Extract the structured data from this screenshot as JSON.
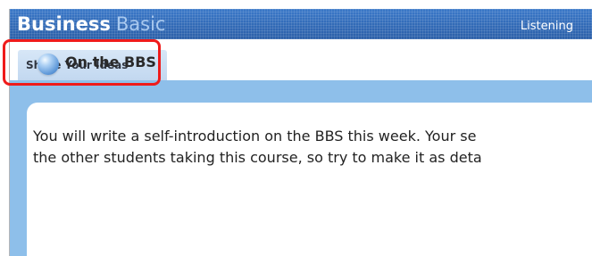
{
  "header": {
    "brand_strong": "Business",
    "brand_light": "Basic",
    "nav_item": "Listening"
  },
  "tabs": [
    {
      "label": "Share Your Ideas",
      "selected": true
    }
  ],
  "section": {
    "title": "On the BBS",
    "icon": "blue-sphere-icon"
  },
  "body": {
    "lines": [
      "You will write a self-introduction on the BBS this week. Your se",
      "the other students taking this course, so try to make it as deta"
    ]
  },
  "highlight": {
    "color": "#ef1b1b",
    "target": "Share Your Ideas"
  },
  "colors": {
    "header": "#2f69b8",
    "tab": "#c9ddf2",
    "content_background": "#8ebfea",
    "highlight": "#ef1b1b"
  }
}
